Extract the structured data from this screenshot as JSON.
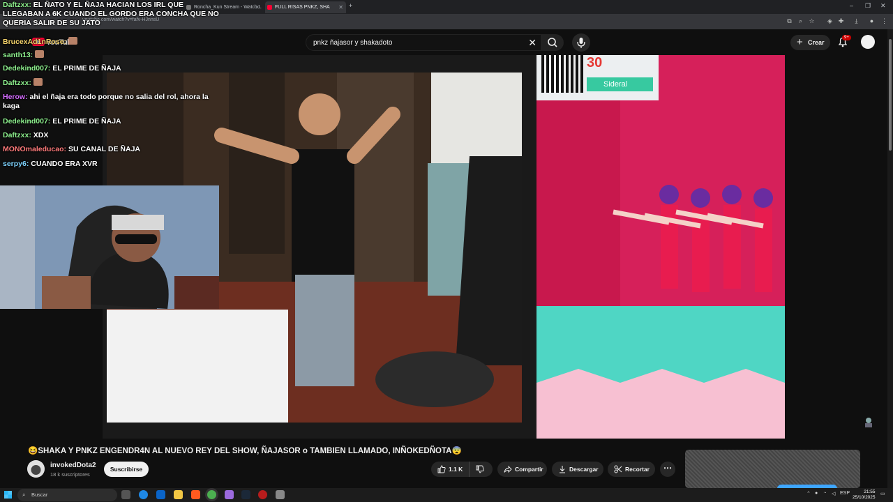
{
  "browser": {
    "tabs": [
      {
        "title": "Roncha_Kun Stream - Watch L"
      },
      {
        "title": "FULL RISAS PNKZ, SHA"
      }
    ],
    "url": "youtube.com/watch?v=fafv-HJnnsU",
    "window_controls": [
      "–",
      "❐",
      "✕"
    ]
  },
  "youtube": {
    "logo_text": "YouTube",
    "search_value": "pnkz  ñajasor y shakadoto",
    "create_label": "Crear",
    "notification_badge": "9+"
  },
  "chat": [
    {
      "user": "Daftzxx:",
      "user_color": "#8ef08e",
      "text": "EL ÑATO Y EL ÑAJA HACIAN LOS IRL QUE LLEGABAN A 6K CUANDO EL GORDO ERA CONCHA QUE NO QUERIA SALIR DE SU JATO"
    },
    {
      "user": "BrucexAd1nRose:",
      "user_color": "#f5d36b",
      "text": "",
      "emote": true
    },
    {
      "user": "santh13:",
      "user_color": "#8ef08e",
      "text": "",
      "emote": true
    },
    {
      "user": "Dedekind007:",
      "user_color": "#8ef08e",
      "text": "EL PRIME DE ÑAJA"
    },
    {
      "user": "Daftzxx:",
      "user_color": "#8ef08e",
      "text": "",
      "emote": true
    },
    {
      "user": "Herow:",
      "user_color": "#d46cff",
      "text": "ahi el ñaja era todo porque no salia del rol, ahora la kaga"
    },
    {
      "user": "Dedekind007:",
      "user_color": "#8ef08e",
      "text": "EL PRIME DE ÑAJA"
    },
    {
      "user": "Daftzxx:",
      "user_color": "#8ef08e",
      "text": "XDX"
    },
    {
      "user": "MONOmaleducao:",
      "user_color": "#ff7b7b",
      "text": "SU CANAL DE ÑAJA"
    },
    {
      "user": "serpy6:",
      "user_color": "#7fd4ff",
      "text": "CUANDO ERA XVR"
    }
  ],
  "game_overlay": {
    "number": "30",
    "badge": "Sideral"
  },
  "video": {
    "title": "😆SHAKA Y PNKZ ENGENDR4N AL NUEVO REY DEL SHOW, ÑAJASOR o TAMBIEN LLAMADO, INÑOKEDÑOTA😨",
    "channel": "invokedDota2",
    "subscribers": "18 k suscriptores",
    "subscribe_label": "Suscribirse",
    "likes": "1.1 K",
    "share_label": "Compartir",
    "download_label": "Descargar",
    "clip_label": "Recortar"
  },
  "taskbar": {
    "search_placeholder": "Buscar",
    "language": "ESP",
    "time": "21:55",
    "date": "25/10/2025"
  },
  "colors": {
    "accent_red": "#ff0033",
    "background": "#0f0f0f",
    "pill": "#272727"
  }
}
